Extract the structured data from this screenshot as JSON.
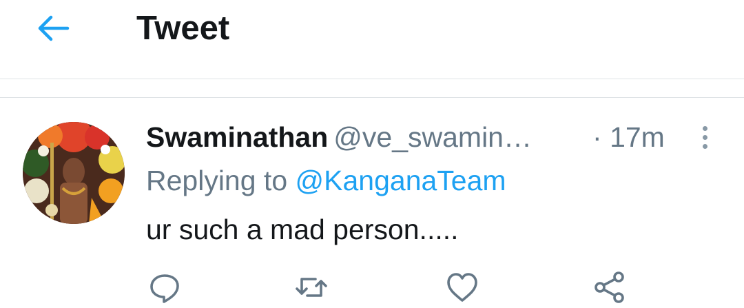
{
  "header": {
    "title": "Tweet",
    "back_icon": "arrow-left-icon",
    "accent": "#1da1f2"
  },
  "tweet": {
    "author_name": "Swaminathan",
    "author_handle": "@ve_swamin…",
    "time_sep": "·",
    "time": "17m",
    "replying_to_label": "Replying to",
    "replying_to_handle": "@KanganaTeam",
    "text": "ur such a mad person.....",
    "more_icon": "more-vertical-icon"
  },
  "actions": [
    "reply-icon",
    "retweet-icon",
    "like-icon",
    "share-icon"
  ]
}
